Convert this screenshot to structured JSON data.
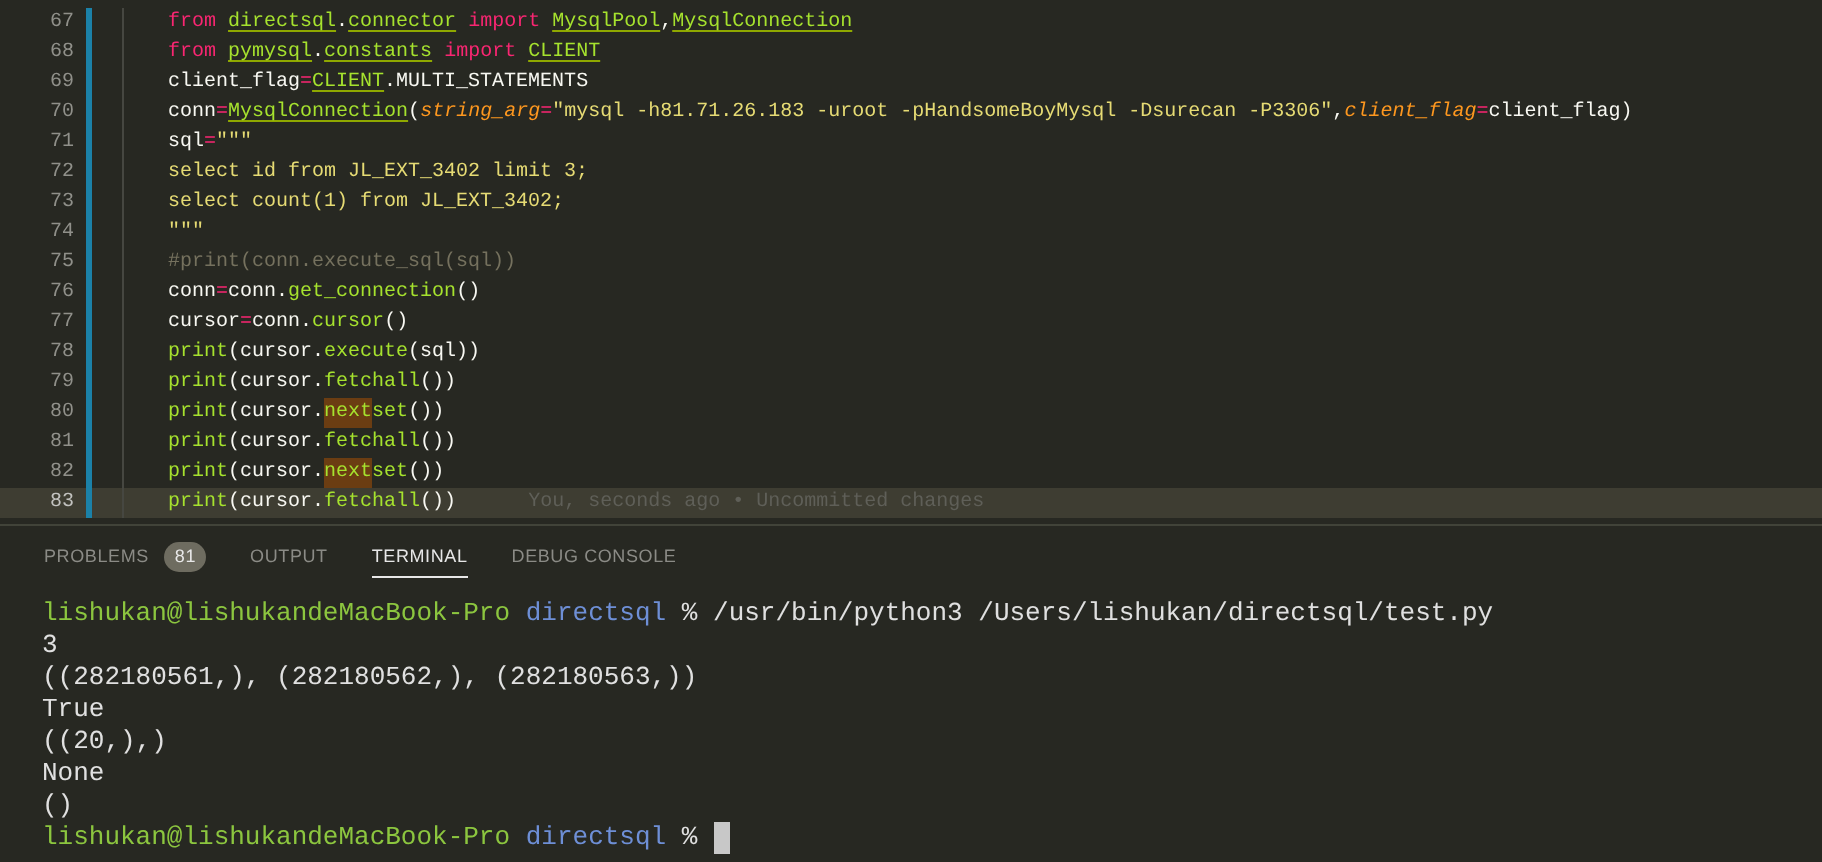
{
  "editor": {
    "lines": [
      {
        "number": "67",
        "current": false,
        "modified": true,
        "tokens": [
          {
            "t": "from ",
            "kind": "kw"
          },
          {
            "t": "directsql",
            "kind": "name",
            "warn": true
          },
          {
            "t": ".",
            "kind": "plain"
          },
          {
            "t": "connector",
            "kind": "name",
            "warn": true
          },
          {
            "t": " import ",
            "kind": "kw"
          },
          {
            "t": "MysqlPool",
            "kind": "name",
            "warn": true
          },
          {
            "t": ",",
            "kind": "plain"
          },
          {
            "t": "MysqlConnection",
            "kind": "name",
            "warn": true
          }
        ]
      },
      {
        "number": "68",
        "current": false,
        "modified": true,
        "tokens": [
          {
            "t": "from ",
            "kind": "kw"
          },
          {
            "t": "pymysql",
            "kind": "name",
            "warn": true
          },
          {
            "t": ".",
            "kind": "plain"
          },
          {
            "t": "constants",
            "kind": "name",
            "warn": true
          },
          {
            "t": " import ",
            "kind": "kw"
          },
          {
            "t": "CLIENT",
            "kind": "name",
            "warn": true
          }
        ]
      },
      {
        "number": "69",
        "current": false,
        "modified": true,
        "tokens": [
          {
            "t": "client_flag",
            "kind": "plain"
          },
          {
            "t": "=",
            "kind": "op"
          },
          {
            "t": "CLIENT",
            "kind": "name",
            "warn": true
          },
          {
            "t": ".MULTI_STATEMENTS",
            "kind": "plain"
          }
        ]
      },
      {
        "number": "70",
        "current": false,
        "modified": true,
        "tokens": [
          {
            "t": "conn",
            "kind": "plain"
          },
          {
            "t": "=",
            "kind": "op"
          },
          {
            "t": "MysqlConnection",
            "kind": "name",
            "warn": true
          },
          {
            "t": "(",
            "kind": "plain"
          },
          {
            "t": "string_arg",
            "kind": "param"
          },
          {
            "t": "=",
            "kind": "op"
          },
          {
            "t": "\"mysql -h81.71.26.183 -uroot -pHandsomeBoyMysql -Dsurecan -P3306\"",
            "kind": "str"
          },
          {
            "t": ",",
            "kind": "plain"
          },
          {
            "t": "client_flag",
            "kind": "param"
          },
          {
            "t": "=",
            "kind": "op"
          },
          {
            "t": "client_flag)",
            "kind": "plain"
          }
        ]
      },
      {
        "number": "71",
        "current": false,
        "modified": true,
        "tokens": [
          {
            "t": "sql",
            "kind": "plain"
          },
          {
            "t": "=",
            "kind": "op"
          },
          {
            "t": "\"\"\"",
            "kind": "str"
          }
        ]
      },
      {
        "number": "72",
        "current": false,
        "modified": true,
        "tokens": [
          {
            "t": "select id from JL_EXT_3402 limit 3;",
            "kind": "str"
          }
        ]
      },
      {
        "number": "73",
        "current": false,
        "modified": true,
        "tokens": [
          {
            "t": "select count(1) from JL_EXT_3402;",
            "kind": "str"
          }
        ]
      },
      {
        "number": "74",
        "current": false,
        "modified": true,
        "tokens": [
          {
            "t": "\"\"\"",
            "kind": "str"
          }
        ]
      },
      {
        "number": "75",
        "current": false,
        "modified": true,
        "tokens": [
          {
            "t": "#print(conn.execute_sql(sql))",
            "kind": "comment"
          }
        ]
      },
      {
        "number": "76",
        "current": false,
        "modified": true,
        "tokens": [
          {
            "t": "conn",
            "kind": "plain"
          },
          {
            "t": "=",
            "kind": "op"
          },
          {
            "t": "conn.",
            "kind": "plain"
          },
          {
            "t": "get_connection",
            "kind": "func"
          },
          {
            "t": "()",
            "kind": "plain"
          }
        ]
      },
      {
        "number": "77",
        "current": false,
        "modified": true,
        "tokens": [
          {
            "t": "cursor",
            "kind": "plain"
          },
          {
            "t": "=",
            "kind": "op"
          },
          {
            "t": "conn.",
            "kind": "plain"
          },
          {
            "t": "cursor",
            "kind": "func"
          },
          {
            "t": "()",
            "kind": "plain"
          }
        ]
      },
      {
        "number": "78",
        "current": false,
        "modified": true,
        "tokens": [
          {
            "t": "print",
            "kind": "func"
          },
          {
            "t": "(cursor.",
            "kind": "plain"
          },
          {
            "t": "execute",
            "kind": "func"
          },
          {
            "t": "(sql))",
            "kind": "plain"
          }
        ]
      },
      {
        "number": "79",
        "current": false,
        "modified": true,
        "tokens": [
          {
            "t": "print",
            "kind": "func"
          },
          {
            "t": "(cursor.",
            "kind": "plain"
          },
          {
            "t": "fetchall",
            "kind": "func"
          },
          {
            "t": "())",
            "kind": "plain"
          }
        ]
      },
      {
        "number": "80",
        "current": false,
        "modified": true,
        "tokens": [
          {
            "t": "print",
            "kind": "func"
          },
          {
            "t": "(cursor.",
            "kind": "plain"
          },
          {
            "t": "next",
            "kind": "func",
            "match": true
          },
          {
            "t": "set",
            "kind": "func"
          },
          {
            "t": "())",
            "kind": "plain"
          }
        ]
      },
      {
        "number": "81",
        "current": false,
        "modified": true,
        "tokens": [
          {
            "t": "print",
            "kind": "func"
          },
          {
            "t": "(cursor.",
            "kind": "plain"
          },
          {
            "t": "fetchall",
            "kind": "func"
          },
          {
            "t": "())",
            "kind": "plain"
          }
        ]
      },
      {
        "number": "82",
        "current": false,
        "modified": true,
        "tokens": [
          {
            "t": "print",
            "kind": "func"
          },
          {
            "t": "(cursor.",
            "kind": "plain"
          },
          {
            "t": "next",
            "kind": "func",
            "match": true
          },
          {
            "t": "set",
            "kind": "func"
          },
          {
            "t": "())",
            "kind": "plain"
          }
        ]
      },
      {
        "number": "83",
        "current": true,
        "modified": true,
        "blame": "You, seconds ago • Uncommitted changes",
        "tokens": [
          {
            "t": "print",
            "kind": "func"
          },
          {
            "t": "(cursor.",
            "kind": "plain"
          },
          {
            "t": "fetchall",
            "kind": "func"
          },
          {
            "t": "())",
            "kind": "plain"
          }
        ]
      }
    ]
  },
  "panel": {
    "tabs": [
      {
        "label": "PROBLEMS",
        "badge": "81",
        "selected": false
      },
      {
        "label": "OUTPUT",
        "selected": false
      },
      {
        "label": "TERMINAL",
        "selected": true
      },
      {
        "label": "DEBUG CONSOLE",
        "selected": false
      }
    ],
    "terminal": [
      {
        "kind": "prompt",
        "user": "lishukan@lishukandeMacBook-Pro",
        "dir": "directsql",
        "sign": "%",
        "command": "/usr/bin/python3 /Users/lishukan/directsql/test.py"
      },
      {
        "kind": "output",
        "text": "3"
      },
      {
        "kind": "output",
        "text": "((282180561,), (282180562,), (282180563,))"
      },
      {
        "kind": "output",
        "text": "True"
      },
      {
        "kind": "output",
        "text": "((20,),)"
      },
      {
        "kind": "output",
        "text": "None"
      },
      {
        "kind": "output",
        "text": "()"
      },
      {
        "kind": "prompt",
        "user": "lishukan@lishukandeMacBook-Pro",
        "dir": "directsql",
        "sign": "%",
        "cursor": true
      }
    ]
  }
}
